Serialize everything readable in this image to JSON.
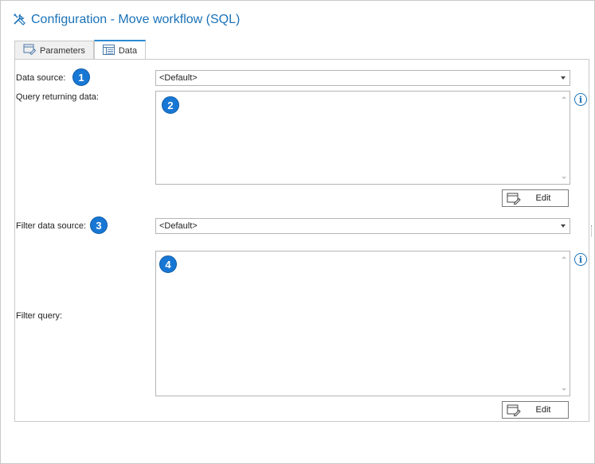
{
  "window": {
    "title": "Configuration - Move workflow (SQL)",
    "title_icon": "tools-icon",
    "accent_color": "#1a72b8"
  },
  "tabs": [
    {
      "label": "Parameters",
      "icon": "parameters-icon",
      "active": false
    },
    {
      "label": "Data",
      "icon": "data-table-icon",
      "active": true
    }
  ],
  "form": {
    "data_source": {
      "label": "Data source:",
      "badge": "1",
      "value": "<Default>"
    },
    "query": {
      "label": "Query returning data:",
      "badge": "2",
      "value": "",
      "edit_label": "Edit"
    },
    "filter_data_source": {
      "label": "Filter data source:",
      "badge": "3",
      "value": "<Default>"
    },
    "filter_query": {
      "label": "Filter query:",
      "badge": "4",
      "value": "",
      "edit_label": "Edit"
    }
  },
  "badge_color": "#1877d4"
}
